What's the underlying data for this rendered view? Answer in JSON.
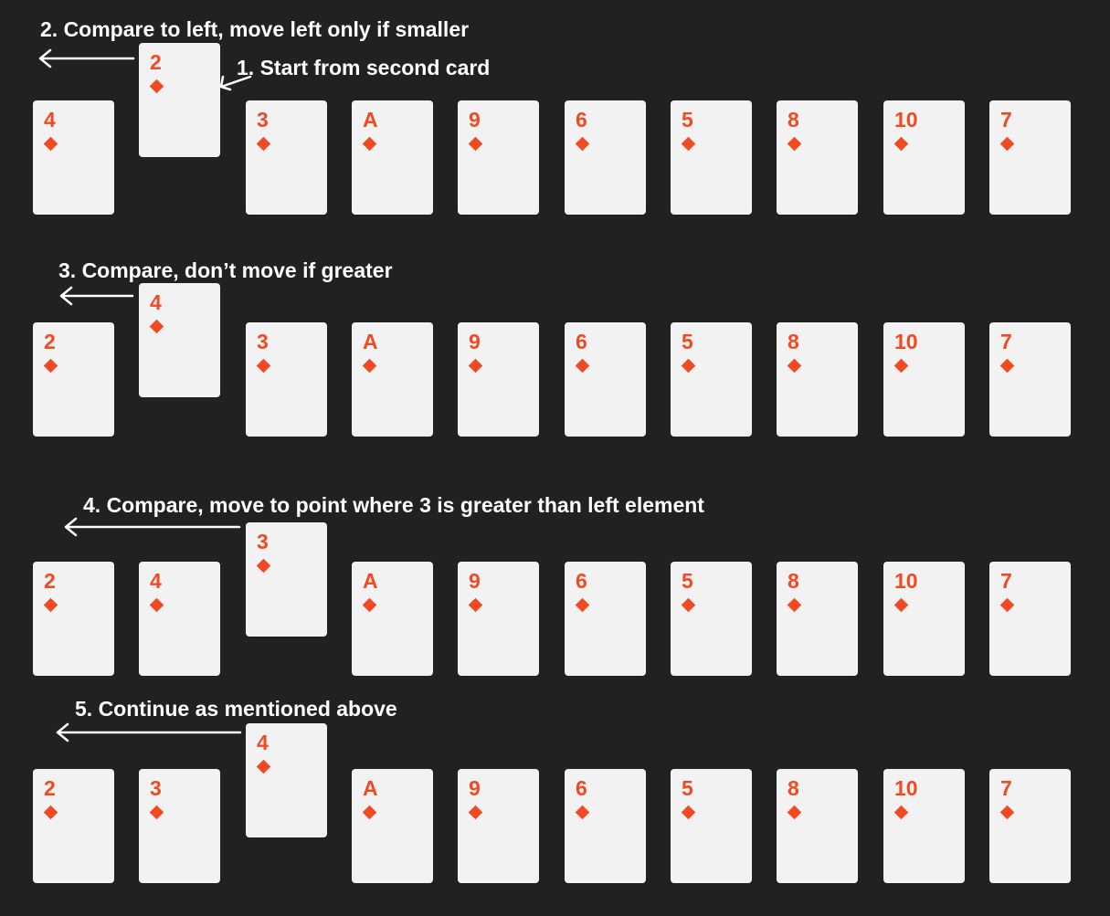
{
  "colors": {
    "background": "#212121",
    "card": "#f2f2f2",
    "rank": "#f04a23",
    "text": "#ffffff"
  },
  "suit_icon": "diamond-icon",
  "steps": [
    {
      "labels": [
        "2. Compare to left, move left only if smaller",
        "1. Start from second card"
      ],
      "lifted_card": "2",
      "row": [
        "4",
        "",
        "3",
        "A",
        "9",
        "6",
        "5",
        "8",
        "10",
        "7"
      ]
    },
    {
      "labels": [
        "3. Compare, don’t move if greater"
      ],
      "lifted_card": "4",
      "row": [
        "2",
        "",
        "3",
        "A",
        "9",
        "6",
        "5",
        "8",
        "10",
        "7"
      ]
    },
    {
      "labels": [
        "4. Compare, move to point where 3 is greater than left element"
      ],
      "lifted_card": "3",
      "row": [
        "2",
        "4",
        "",
        "A",
        "9",
        "6",
        "5",
        "8",
        "10",
        "7"
      ]
    },
    {
      "labels": [
        "5. Continue as mentioned above"
      ],
      "lifted_card": "4",
      "row": [
        "2",
        "3",
        "",
        "A",
        "9",
        "6",
        "5",
        "8",
        "10",
        "7"
      ]
    }
  ]
}
